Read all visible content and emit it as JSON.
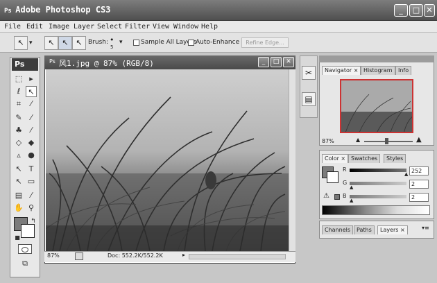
{
  "window": {
    "title": "Adobe Photoshop CS3",
    "min": "_",
    "max": "□",
    "close": "✕"
  },
  "menu": [
    "File",
    "Edit",
    "Image",
    "Layer",
    "Select",
    "Filter",
    "View",
    "Window",
    "Help"
  ],
  "options": {
    "brush_label": "Brush:",
    "brush_size": "5",
    "sample_all_layers": "Sample All Layers",
    "auto_enhance": "Auto-Enhance",
    "refine_edge": "Refine Edge..."
  },
  "tools": {
    "logo": "Ps"
  },
  "document": {
    "title": "风1.jpg @ 87% (RGB/8)",
    "zoom": "87%",
    "doc_size": "Doc: 552.2K/552.2K"
  },
  "navigator": {
    "tabs": [
      "Navigator",
      "Histogram",
      "Info"
    ],
    "zoom": "87%"
  },
  "color_panel": {
    "tabs": [
      "Color",
      "Swatches",
      "Styles"
    ],
    "r_label": "R",
    "g_label": "G",
    "b_label": "B",
    "r": "252",
    "g": "2",
    "b": "2"
  },
  "layers_panel": {
    "tabs": [
      "Channels",
      "Paths",
      "Layers"
    ]
  },
  "icons": {
    "move": "move-icon",
    "lasso": "lasso-icon",
    "brush": "brush-icon",
    "hand": "hand-icon",
    "zoom": "zoom-icon",
    "warning": "gamut-warning-icon"
  }
}
